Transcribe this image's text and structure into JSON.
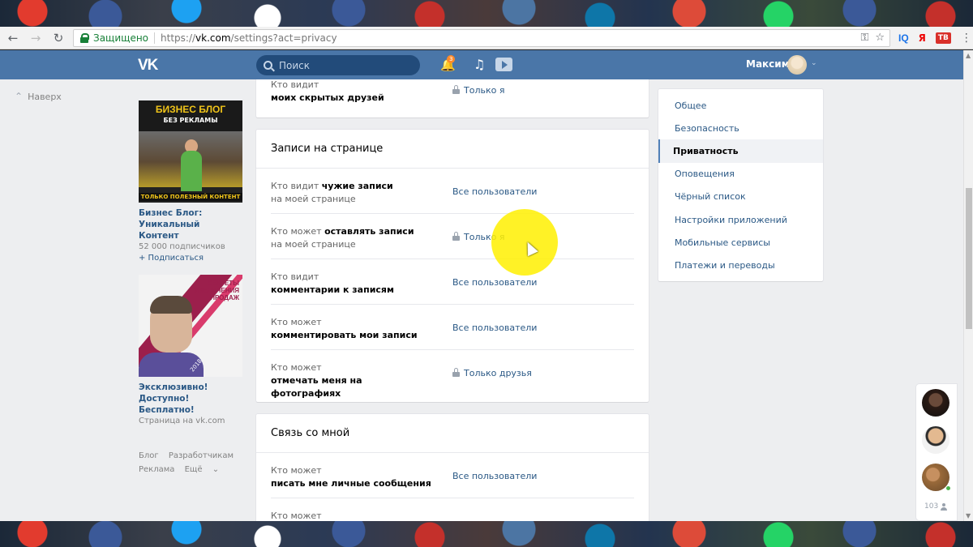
{
  "browser": {
    "secure_label": "Защищено",
    "url_scheme": "https://",
    "url_host": "vk.com",
    "url_path": "/settings?act=privacy",
    "ext_iq": "IQ",
    "ext_ya": "Я",
    "ext_tv": "ТВ"
  },
  "header": {
    "logo": "VK",
    "search_placeholder": "Поиск",
    "notifications_count": "3",
    "user_name": "Максим"
  },
  "left": {
    "back_to_top": "Наверх",
    "ads": [
      {
        "image_title": "БИЗНЕС БЛОГ",
        "image_subtitle": "БЕЗ РЕКЛАМЫ",
        "image_bar": "ТОЛЬКО ПОЛЕЗНЫЙ КОНТЕНТ",
        "title": "Бизнес Блог: Уникальный Контент",
        "meta": "52 000 подписчиков",
        "action": "+ Подписаться"
      },
      {
        "image_title": "СЕКРЕТЫ УВЕЛИЧЕНИЯ ПРОДАЖ",
        "image_year": "2018",
        "title": "Эксклюзивно! Доступно! Бесплатно!",
        "meta": "Страница на vk.com"
      }
    ],
    "links": [
      "Блог",
      "Разработчикам",
      "Реклама",
      "Ещё"
    ]
  },
  "privacy": {
    "top_row": {
      "q1": "Кто видит",
      "q2": "моих скрытых друзей",
      "value": "Только я",
      "locked": true
    },
    "posts": {
      "title": "Записи на странице",
      "rows": [
        {
          "q_prefix": "Кто видит ",
          "q_bold": "чужие записи",
          "q_line2": "на моей странице",
          "value": "Все пользователи",
          "locked": false
        },
        {
          "q_prefix": "Кто может ",
          "q_bold": "оставлять записи",
          "q_line2": "на моей странице",
          "value": "Только я",
          "locked": true
        },
        {
          "q_prefix": "Кто видит",
          "q_bold": "",
          "q_line2": "комментарии к записям",
          "value": "Все пользователи",
          "locked": false,
          "line2_bold": true
        },
        {
          "q_prefix": "Кто может",
          "q_bold": "",
          "q_line2": "комментировать мои записи",
          "value": "Все пользователи",
          "locked": false,
          "line2_bold": true
        },
        {
          "q_prefix": "Кто может",
          "q_bold": "",
          "q_line2": "отмечать меня на фотографиях",
          "value": "Только друзья",
          "locked": true,
          "line2_bold": true
        }
      ]
    },
    "contact": {
      "title": "Связь со мной",
      "rows": [
        {
          "q_prefix": "Кто может",
          "q_line2": "писать мне личные сообщения",
          "value": "Все пользователи"
        },
        {
          "q_prefix": "Кто может",
          "q_line2": "",
          "value": ""
        }
      ]
    }
  },
  "settings_menu": {
    "items": [
      "Общее",
      "Безопасность",
      "Приватность",
      "Оповещения",
      "Чёрный список",
      "Настройки приложений",
      "Мобильные сервисы",
      "Платежи и переводы"
    ],
    "active": "Приватность"
  },
  "friends": {
    "count": "103"
  },
  "colors": {
    "vk_blue": "#4a76a8",
    "link": "#2a5885",
    "highlight": "#fff000"
  }
}
